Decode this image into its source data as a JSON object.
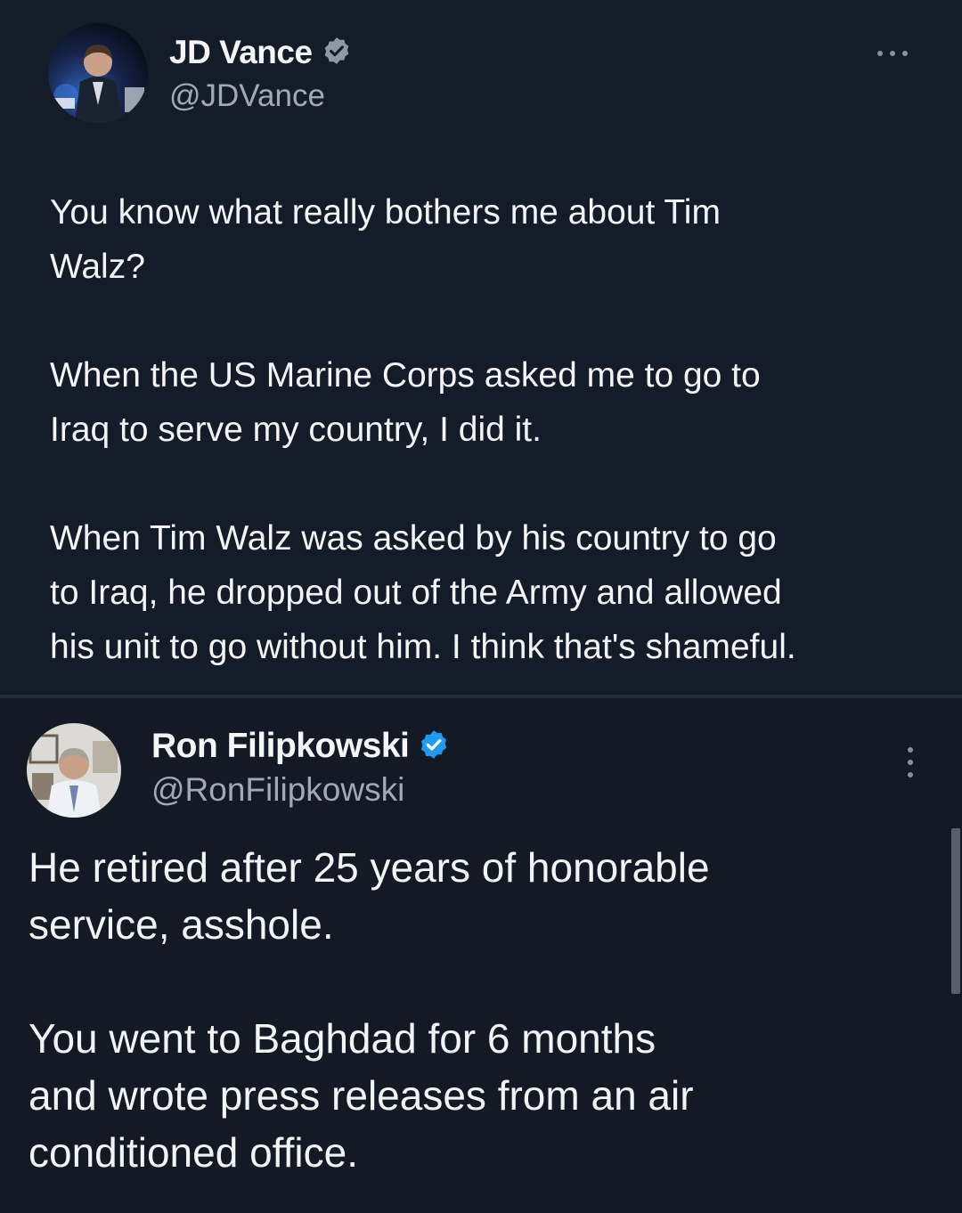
{
  "tweets": [
    {
      "name": "JD Vance",
      "handle": "@JDVance",
      "verified": true,
      "text": "You know what really bothers me about Tim\nWalz?\n\nWhen the US Marine Corps asked me to go to\nIraq to serve my country, I did it.\n\nWhen Tim Walz was asked by his country to go\nto Iraq, he dropped out of the Army and allowed\nhis unit to go without him. I think that's shameful."
    },
    {
      "name": "Ron Filipkowski",
      "handle": "@RonFilipkowski",
      "verified": true,
      "text": "He retired after 25 years of honorable\nservice, asshole.\n\nYou went to Baghdad for 6 months\nand wrote press releases from an air\nconditioned office."
    }
  ],
  "icons": {
    "verified_badge": "verified-badge-icon",
    "more_options": "more-options-icon"
  },
  "colors": {
    "background": "#151d2a",
    "verified_blue": "#1d9bf0",
    "handle_gray": "#a2a9b5"
  }
}
